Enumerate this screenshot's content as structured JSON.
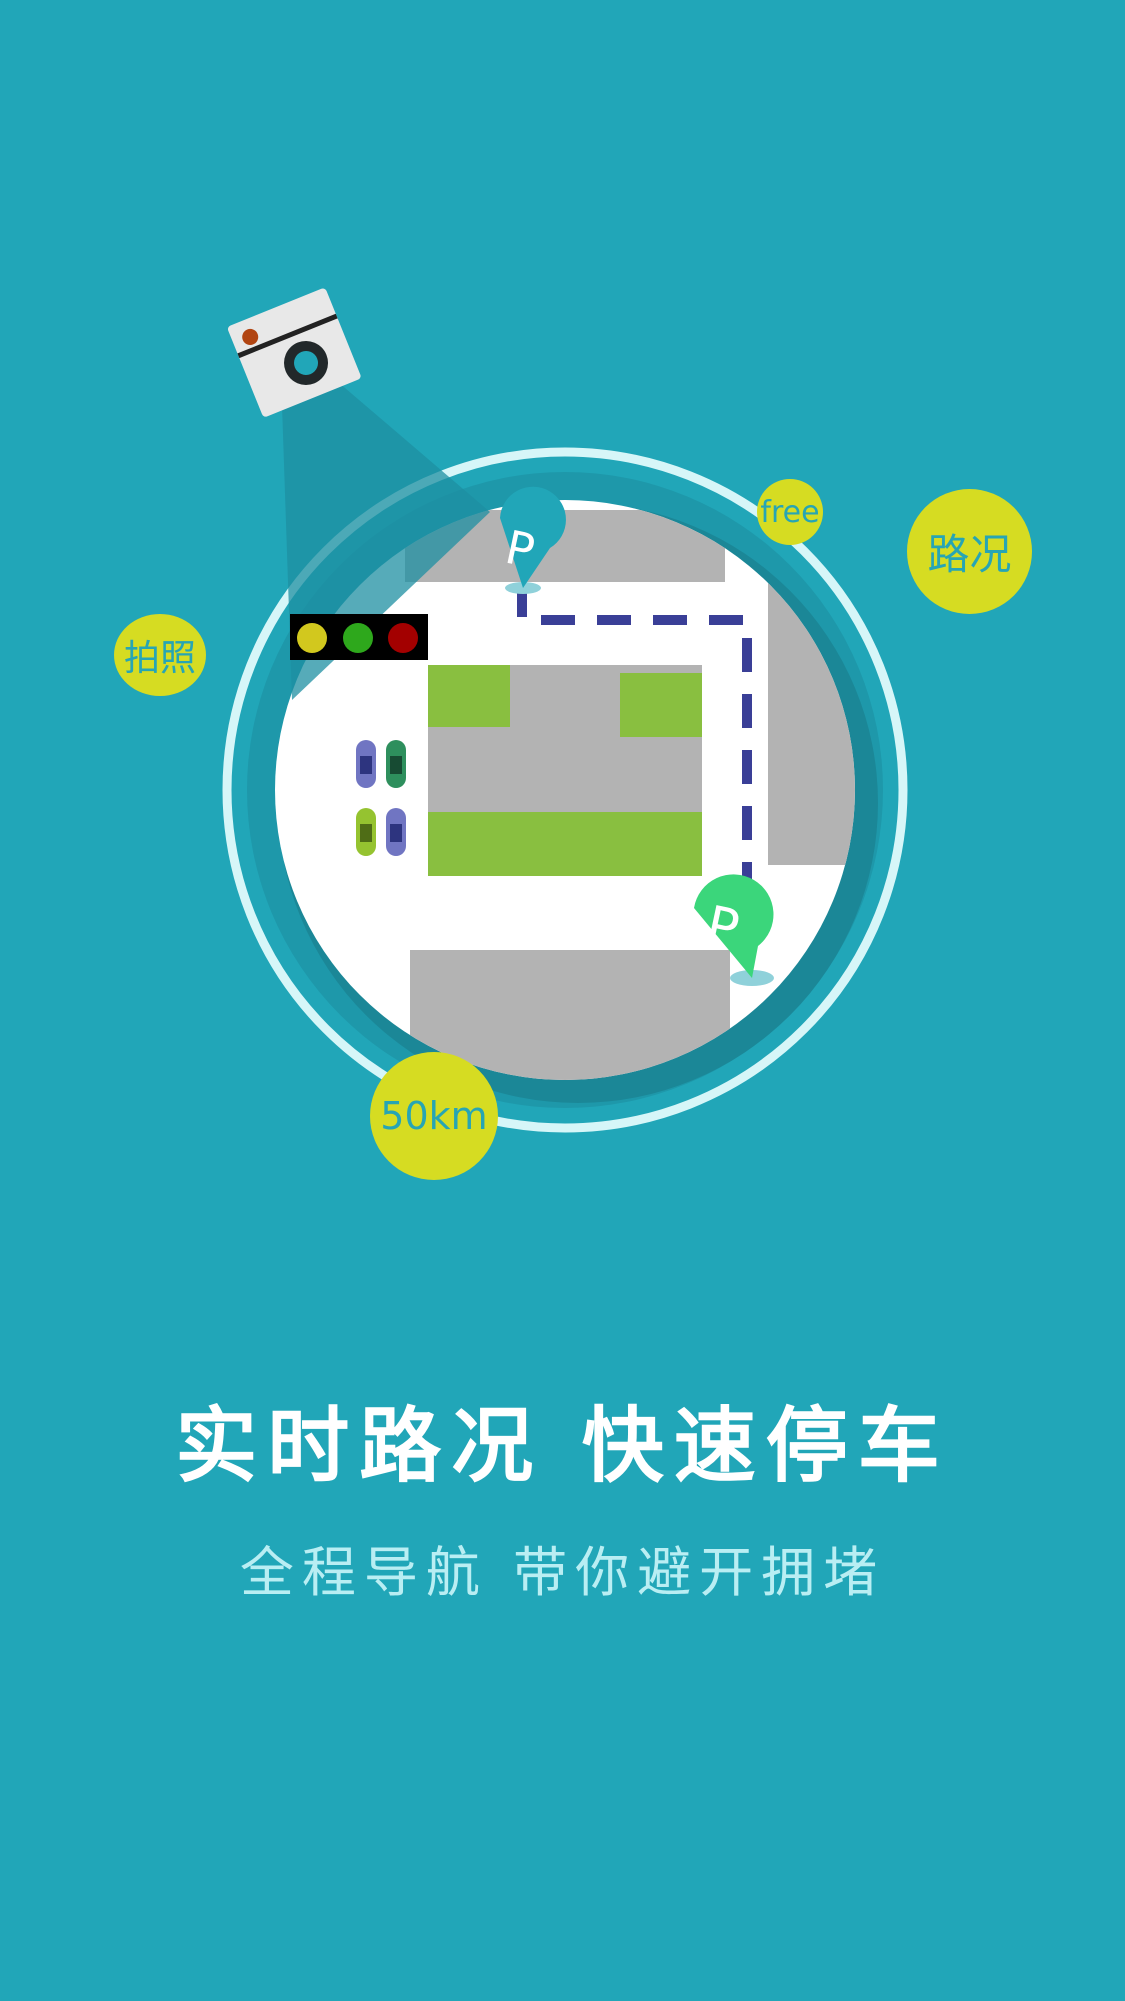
{
  "guide": {
    "headline": "实时路况 快速停车",
    "subline": "全程导航 带你避开拥堵"
  },
  "illustration": {
    "badges": {
      "free": "free",
      "road": "路况",
      "photo": "拍照",
      "distance": "50km"
    },
    "parking_marker_letter": "P"
  },
  "colors": {
    "background": "#21a6b8",
    "badge": "#d6dc22",
    "badge_text": "#27a5b4",
    "route": "#3a3f97",
    "park_green": "#3bd67b",
    "park_teal": "#21a6b8",
    "building": "#b3b3b3",
    "grass": "#89bf40"
  },
  "icons": [
    "camera-icon",
    "traffic-light-icon",
    "car-icon",
    "parking-pin-icon"
  ]
}
